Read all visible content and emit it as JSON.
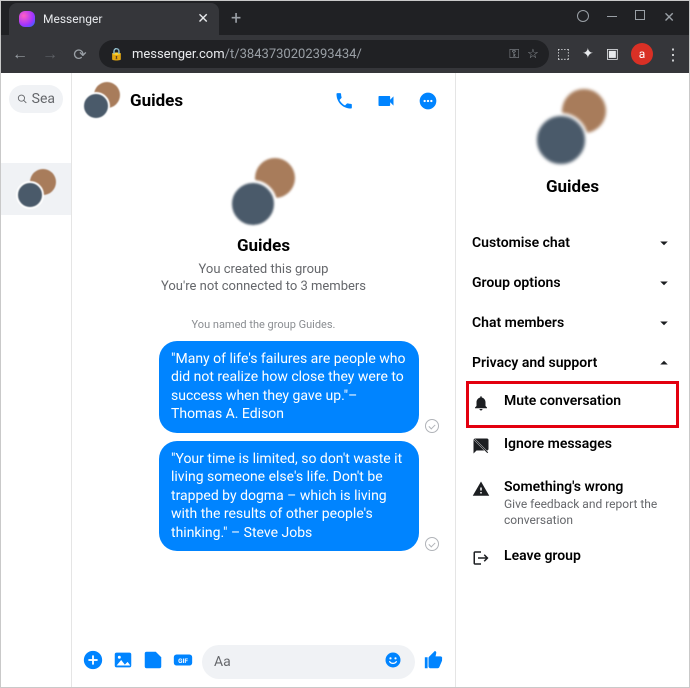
{
  "browser": {
    "tab_title": "Messenger",
    "url_host": "messenger.com",
    "url_path": "/t/3843730202393434/",
    "avatar_letter": "a"
  },
  "sidebar": {
    "search_placeholder": "Sea"
  },
  "chat": {
    "title": "Guides",
    "intro_title": "Guides",
    "intro_line1": "You created this group",
    "intro_line2": "You're not connected to 3 members",
    "system_msg": "You named the group Guides.",
    "messages": [
      "\"Many of life's failures are people who did not realize how close they were to success when they gave up.\"– Thomas A. Edison",
      "\"Your time is limited, so don't waste it living someone else's life. Don't be trapped by dogma – which is living with the results of other people's thinking.\" – Steve Jobs"
    ],
    "composer_placeholder": "Aa"
  },
  "info": {
    "title": "Guides",
    "sections": [
      {
        "label": "Customise chat",
        "expanded": false
      },
      {
        "label": "Group options",
        "expanded": false
      },
      {
        "label": "Chat members",
        "expanded": false
      },
      {
        "label": "Privacy and support",
        "expanded": true
      }
    ],
    "privacy_items": {
      "mute": "Mute conversation",
      "ignore": "Ignore messages",
      "wrong_title": "Something's wrong",
      "wrong_sub": "Give feedback and report the conversation",
      "leave": "Leave group"
    }
  }
}
